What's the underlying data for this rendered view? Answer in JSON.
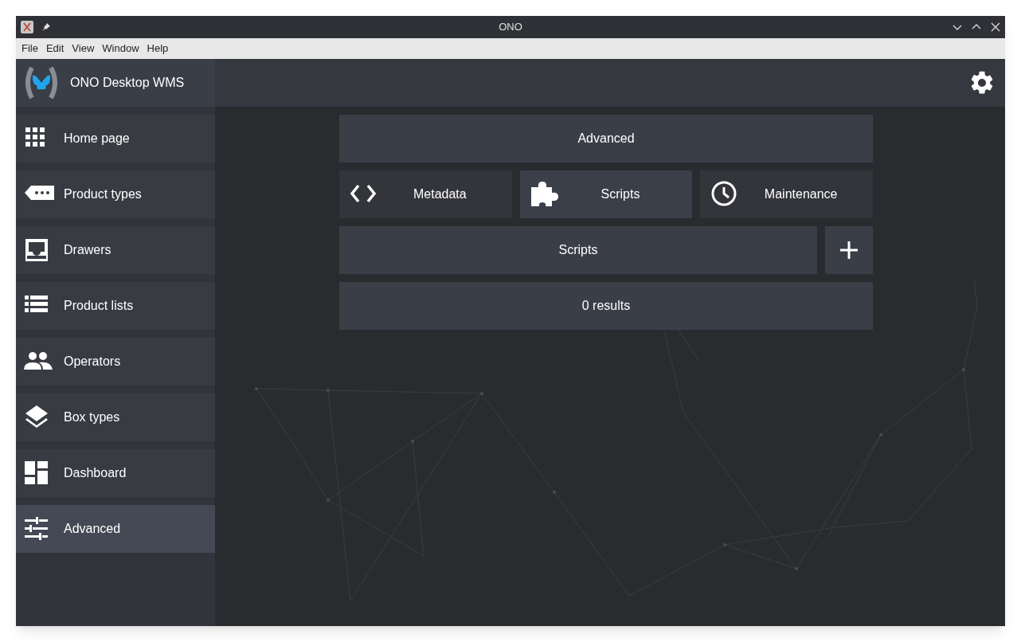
{
  "window": {
    "title": "ONO"
  },
  "menu": [
    "File",
    "Edit",
    "View",
    "Window",
    "Help"
  ],
  "app": {
    "title": "ONO Desktop WMS"
  },
  "nav": [
    {
      "label": "Home page",
      "selected": false
    },
    {
      "label": "Product types",
      "selected": false
    },
    {
      "label": "Drawers",
      "selected": false
    },
    {
      "label": "Product lists",
      "selected": false
    },
    {
      "label": "Operators",
      "selected": false
    },
    {
      "label": "Box types",
      "selected": false
    },
    {
      "label": "Dashboard",
      "selected": false
    },
    {
      "label": "Advanced",
      "selected": true
    }
  ],
  "section": {
    "title": "Advanced"
  },
  "tabs": [
    {
      "label": "Metadata",
      "selected": false
    },
    {
      "label": "Scripts",
      "selected": true
    },
    {
      "label": "Maintenance",
      "selected": false
    }
  ],
  "list": {
    "title": "Scripts",
    "results": "0 results"
  }
}
